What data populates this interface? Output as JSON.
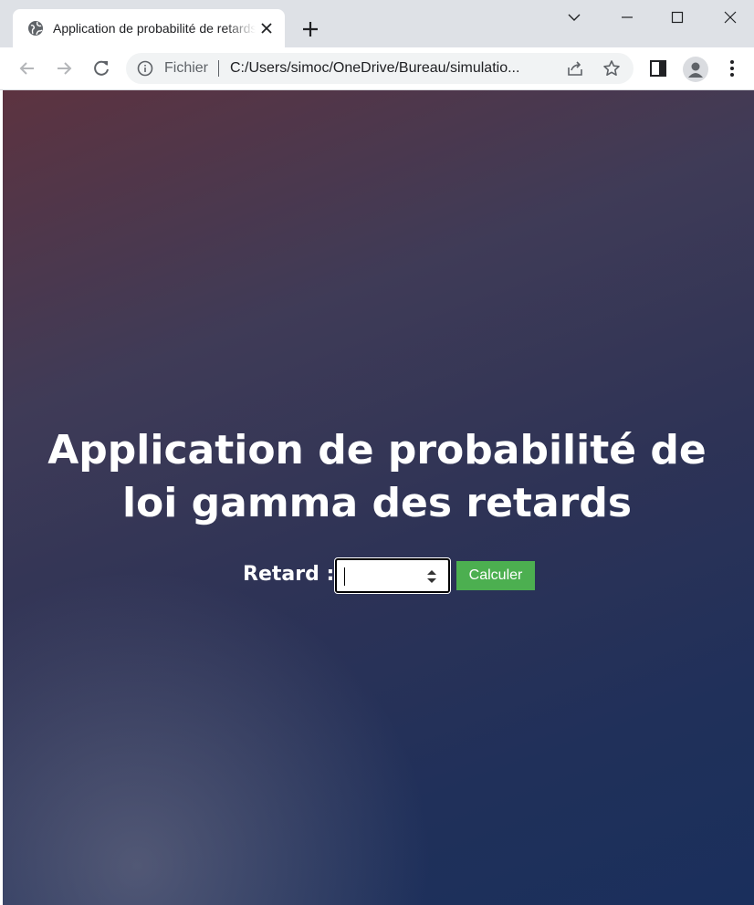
{
  "browser": {
    "tab": {
      "title": "Application de probabilité de retards",
      "favicon": "globe-icon"
    },
    "new_tab_icon": "plus-icon",
    "window_controls": [
      "chevron-down-icon",
      "minimize-icon",
      "maximize-icon",
      "close-icon"
    ],
    "toolbar": {
      "back_icon": "arrow-left-icon",
      "forward_icon": "arrow-right-icon",
      "reload_icon": "reload-icon",
      "scheme_label": "Fichier",
      "url": "C:/Users/simoc/OneDrive/Bureau/simulatio...",
      "share_icon": "share-icon",
      "bookmark_icon": "star-icon",
      "side_panel_icon": "side-panel-icon",
      "profile_icon": "avatar-icon",
      "menu_icon": "kebab-menu-icon"
    }
  },
  "page": {
    "title": "Application de probabilité de loi gamma des retards",
    "form": {
      "label": "Retard :",
      "input_value": "",
      "button_label": "Calculer"
    }
  },
  "colors": {
    "tabstrip_bg": "#dee1e6",
    "button_green": "#4caf50",
    "gradient_top_left": "#5d3340",
    "gradient_bottom_right": "#1a2f5c"
  }
}
